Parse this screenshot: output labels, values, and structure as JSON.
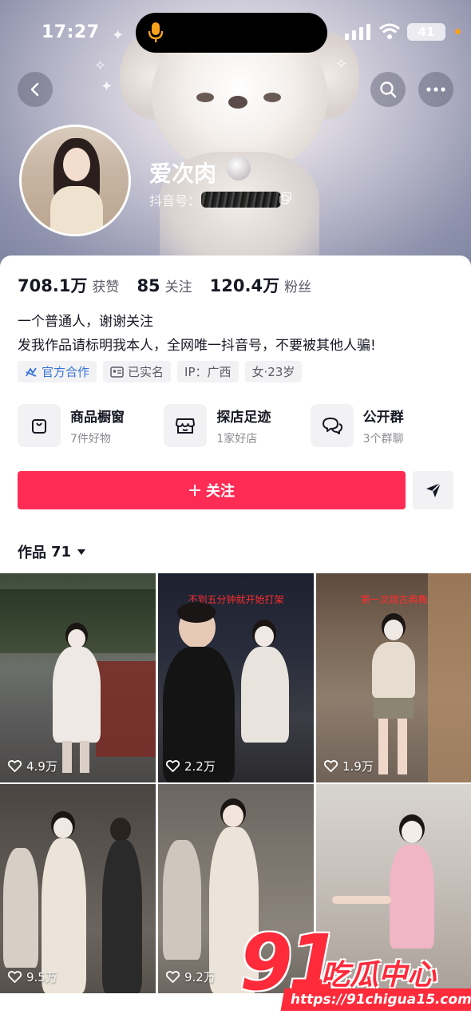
{
  "status_bar": {
    "time": "17:27",
    "battery": "41"
  },
  "profile": {
    "nickname": "爱次肉",
    "douyin_id_label": "抖音号："
  },
  "stats": [
    {
      "value": "708.1万",
      "label": "获赞"
    },
    {
      "value": "85",
      "label": "关注"
    },
    {
      "value": "120.4万",
      "label": "粉丝"
    }
  ],
  "bio": [
    "一个普通人，谢谢关注",
    "发我作品请标明我本人，全网唯一抖音号，不要被其他人骗!"
  ],
  "tags": [
    {
      "label": "官方合作",
      "icon": "official-collab-icon"
    },
    {
      "label": "已实名",
      "icon": "id-card-icon"
    },
    {
      "label": "IP：广西",
      "icon": ""
    },
    {
      "label": "女·23岁",
      "icon": ""
    }
  ],
  "features": [
    {
      "title": "商品橱窗",
      "sub": "7件好物",
      "icon": "shopping-bag-icon"
    },
    {
      "title": "探店足迹",
      "sub": "1家好店",
      "icon": "store-icon"
    },
    {
      "title": "公开群",
      "sub": "3个群聊",
      "icon": "chat-bubbles-icon"
    }
  ],
  "follow_button": {
    "label": "关注"
  },
  "works": {
    "label": "作品",
    "count": "71"
  },
  "videos": [
    {
      "likes": "4.9万",
      "caption": ""
    },
    {
      "likes": "2.2万",
      "caption": "不到五分钟就开始打架"
    },
    {
      "likes": "1.9万",
      "caption": "第一次跳古典舞"
    },
    {
      "likes": "9.5万",
      "caption": ""
    },
    {
      "likes": "9.2万",
      "caption": ""
    },
    {
      "likes": "",
      "caption": ""
    }
  ],
  "watermark": {
    "number": "91",
    "text": "吃瓜中心",
    "url": "https://91chigua15.com"
  },
  "colors": {
    "accent": "#fe2c55",
    "official": "#3773d8"
  }
}
